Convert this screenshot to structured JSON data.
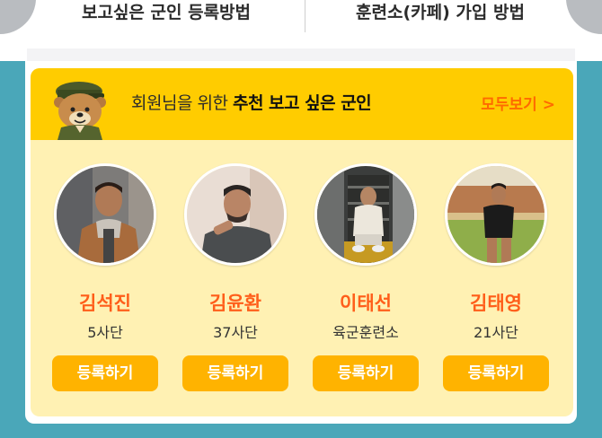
{
  "tabs": {
    "left_label": "보고싶은 군인 등록방법",
    "right_label": "훈련소(카페) 가입 방법"
  },
  "recommend": {
    "title_prefix": "회원님을 위한 ",
    "title_emphasis": "추천 보고 싶은 군인",
    "see_all_label": "모두보기 >"
  },
  "soldiers": [
    {
      "name": "김석진",
      "unit": "5사단",
      "button_label": "등록하기"
    },
    {
      "name": "김윤환",
      "unit": "37사단",
      "button_label": "등록하기"
    },
    {
      "name": "이태선",
      "unit": "육군훈련소",
      "button_label": "등록하기"
    },
    {
      "name": "김태영",
      "unit": "21사단",
      "button_label": "등록하기"
    }
  ],
  "colors": {
    "background": "#4aa7b9",
    "header_yellow": "#ffcc00",
    "card_yellow": "#fff1b3",
    "button_orange": "#ffb300",
    "name_orange": "#ff5e1a"
  }
}
